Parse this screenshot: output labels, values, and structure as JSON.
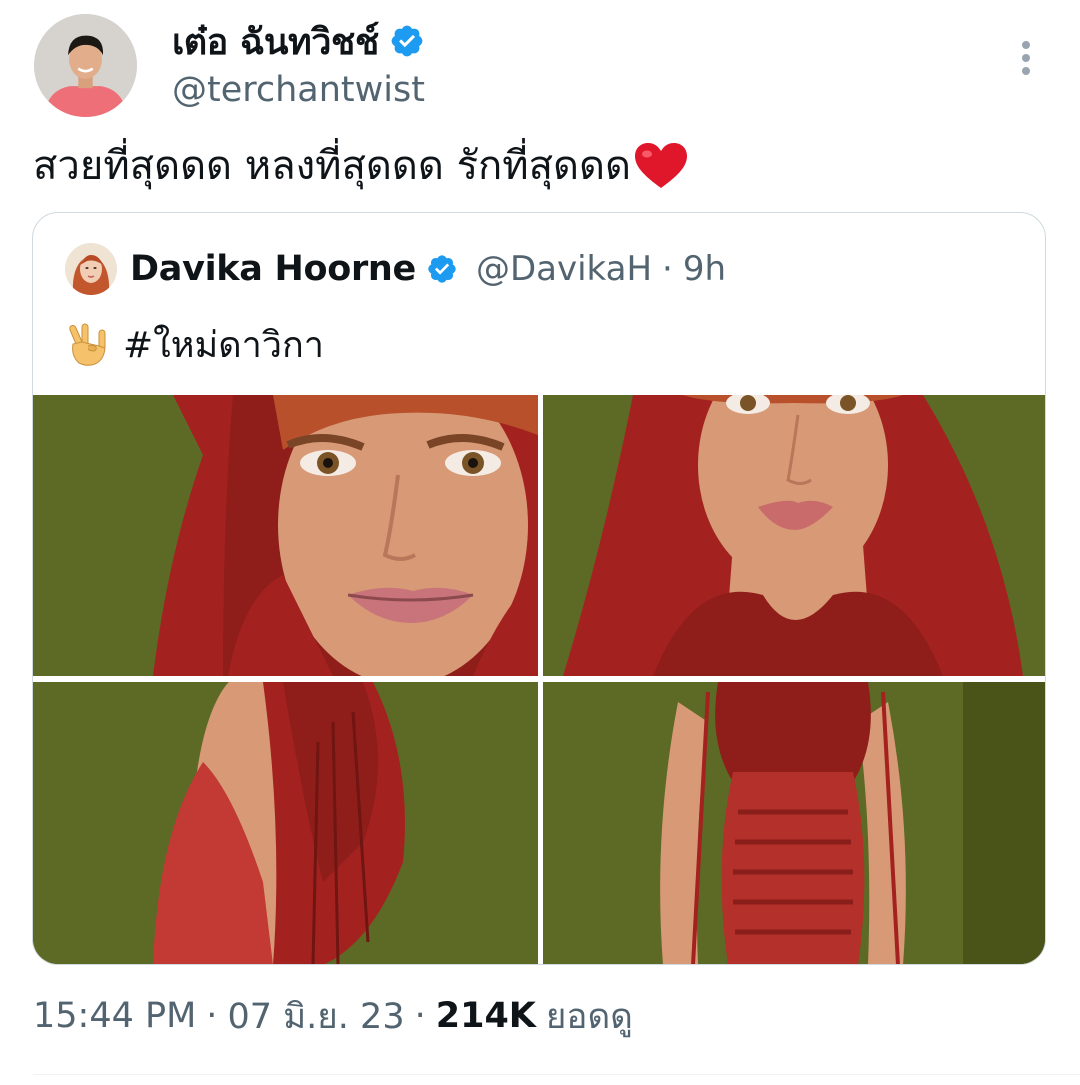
{
  "author": {
    "name": "เต๋อ ฉันทวิชช์",
    "handle": "@terchantwist",
    "verified": true
  },
  "tweet": {
    "text": "สวยที่สุดดด หลงที่สุดดด รักที่สุดดด",
    "emoji": "heart-icon"
  },
  "quoted_tweet": {
    "name": "Davika Hoorne",
    "handle": "@DavikaH",
    "separator": "·",
    "time": "9h",
    "text": "#ใหม่ดาวิกา",
    "emoji": "love-you-gesture-icon",
    "photo_count": 4
  },
  "meta": {
    "time": "15:44 PM",
    "sep1": "·",
    "date": "07 มิ.ย. 23",
    "sep2": "·",
    "views_count": "214K",
    "views_label": "ยอดดู"
  },
  "colors": {
    "verified_blue": "#1d9bf0",
    "secondary_text": "#536471",
    "primary_text": "#0f1419",
    "border": "#cfd9de",
    "photo_background": "#5d6a25",
    "outfit_red": "#a8231f"
  }
}
